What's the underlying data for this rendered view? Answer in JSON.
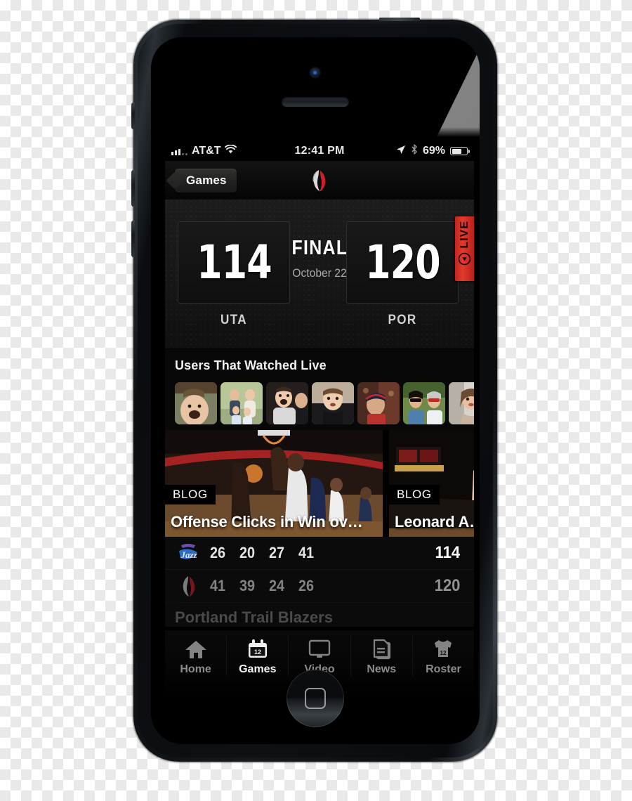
{
  "device": {
    "name": "iPhone 5 black"
  },
  "status_bar": {
    "carrier": "AT&T",
    "time": "12:41 PM",
    "battery_percent": "69%",
    "icons": [
      "signal-bars-icon",
      "wifi-icon",
      "location-arrow-icon",
      "bluetooth-icon",
      "battery-icon"
    ]
  },
  "nav_bar": {
    "back_label": "Games",
    "logo": "portland-trail-blazers-logo"
  },
  "scoreboard": {
    "away_score": "114",
    "away_abbr": "UTA",
    "home_score": "120",
    "home_abbr": "POR",
    "status": "FINAL",
    "date": "October 22",
    "live_badge": "LIVE",
    "live_color": "#d42b22"
  },
  "watched": {
    "title": "Users That Watched Live",
    "avatar_count": 7,
    "avatars": [
      "avatar-man-laughing",
      "avatar-family-group",
      "avatar-two-men",
      "avatar-young-man",
      "avatar-fan-in-cap",
      "avatar-couple-sunglasses",
      "avatar-woman-smiling"
    ]
  },
  "cards": [
    {
      "tag": "BLOG",
      "title": "Offense Clicks in Win ov…",
      "photo": "basketball-game-action-photo"
    },
    {
      "tag": "BLOG",
      "title": "Leonard A…",
      "photo": "player-flexing-arena-photo"
    }
  ],
  "box_score": {
    "rows": [
      {
        "team": "jazz-logo",
        "team_name": "Utah Jazz",
        "quarters": [
          "26",
          "20",
          "27",
          "41"
        ],
        "total": "114"
      },
      {
        "team": "blazers-logo",
        "team_name": "Portland Trail Blazers",
        "quarters": [
          "41",
          "39",
          "24",
          "26"
        ],
        "total": "120"
      }
    ]
  },
  "tab_bar": {
    "active": "Games",
    "tabs": [
      {
        "label": "Home",
        "icon": "home-icon"
      },
      {
        "label": "Games",
        "icon": "calendar-icon"
      },
      {
        "label": "Video",
        "icon": "tv-monitor-icon"
      },
      {
        "label": "News",
        "icon": "news-pages-icon"
      },
      {
        "label": "Roster",
        "icon": "jersey-icon"
      }
    ],
    "page_dots": 2,
    "active_dot": 1
  }
}
